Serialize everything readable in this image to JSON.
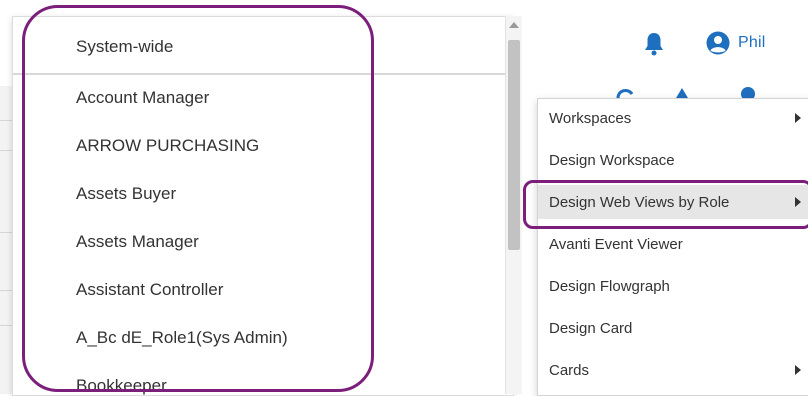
{
  "header": {
    "user_name": "Phil",
    "icons": [
      "bell-icon",
      "user-circle-icon"
    ],
    "accent_color": "#1f6fbf"
  },
  "role_menu": {
    "items": [
      "System-wide",
      "Account Manager",
      "ARROW PURCHASING",
      "Assets Buyer",
      "Assets Manager",
      "Assistant Controller",
      "A_Bc dE_Role1(Sys Admin)",
      "Bookkeeper"
    ]
  },
  "settings_menu": {
    "items": [
      {
        "label": "Workspaces",
        "has_submenu": true
      },
      {
        "label": "Design Workspace",
        "has_submenu": false
      },
      {
        "label": "Design Web Views by Role",
        "has_submenu": true,
        "highlighted": true
      },
      {
        "label": "Avanti Event Viewer",
        "has_submenu": false
      },
      {
        "label": "Design Flowgraph",
        "has_submenu": false
      },
      {
        "label": "Design Card",
        "has_submenu": false
      },
      {
        "label": "Cards",
        "has_submenu": true
      }
    ]
  },
  "annotation_color": "#7b1f7b"
}
